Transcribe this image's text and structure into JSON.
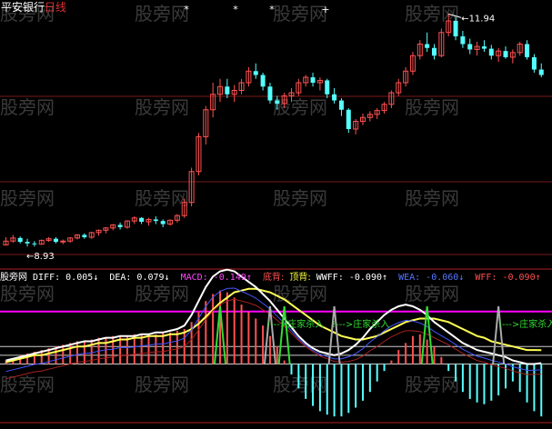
{
  "title": {
    "name": "平安银行",
    "period": "日线"
  },
  "price_annotations": {
    "high": "11.94",
    "low": "8.93"
  },
  "indicator_bar": {
    "name": "股旁网",
    "diff": "DIFF: 0.005↓",
    "dea": "DEA: 0.079↓",
    "macd": "MACD: -0.149↑",
    "bottom_div": "底背:",
    "top_div": "顶背:",
    "wwff": "WWFF: -0.090↑",
    "wea": "WEA: -0.060↓",
    "wff": "WFF: -0.090↑"
  },
  "signal_label": "!--->庄家杀入",
  "watermark": "股旁网",
  "colors": {
    "up": "#ff5050",
    "down": "#55ffff",
    "diff_line": "#ffffff",
    "dea_line": "#ffff55",
    "signal_line": "#ff00ff",
    "grid": "#7a1a1a",
    "sig_green": "#33dd33"
  },
  "chart_data": [
    {
      "type": "candlestick",
      "series": [
        {
          "name": "K线",
          "ohlc": [
            [
              8.95,
              9.05,
              8.95,
              9.0
            ],
            [
              9.0,
              9.08,
              8.98,
              9.04
            ],
            [
              9.04,
              9.06,
              8.97,
              8.99
            ],
            [
              8.99,
              9.03,
              8.93,
              8.97
            ],
            [
              8.97,
              9.0,
              8.93,
              8.96
            ],
            [
              8.96,
              9.02,
              8.95,
              9.01
            ],
            [
              9.01,
              9.05,
              8.99,
              9.03
            ],
            [
              9.03,
              9.05,
              8.97,
              8.99
            ],
            [
              8.99,
              9.02,
              8.96,
              9.0
            ],
            [
              9.0,
              9.05,
              8.98,
              9.04
            ],
            [
              9.04,
              9.09,
              9.02,
              9.08
            ],
            [
              9.08,
              9.1,
              9.03,
              9.05
            ],
            [
              9.05,
              9.12,
              9.03,
              9.11
            ],
            [
              9.11,
              9.15,
              9.07,
              9.14
            ],
            [
              9.14,
              9.18,
              9.1,
              9.17
            ],
            [
              9.17,
              9.22,
              9.14,
              9.21
            ],
            [
              9.21,
              9.24,
              9.15,
              9.18
            ],
            [
              9.18,
              9.27,
              9.16,
              9.26
            ],
            [
              9.26,
              9.32,
              9.22,
              9.3
            ],
            [
              9.3,
              9.31,
              9.22,
              9.25
            ],
            [
              9.25,
              9.3,
              9.2,
              9.28
            ],
            [
              9.28,
              9.32,
              9.22,
              9.26
            ],
            [
              9.26,
              9.28,
              9.18,
              9.22
            ],
            [
              9.22,
              9.28,
              9.2,
              9.27
            ],
            [
              9.27,
              9.35,
              9.24,
              9.33
            ],
            [
              9.33,
              9.55,
              9.3,
              9.5
            ],
            [
              9.5,
              9.95,
              9.45,
              9.9
            ],
            [
              9.9,
              10.4,
              9.85,
              10.35
            ],
            [
              10.35,
              10.75,
              10.25,
              10.7
            ],
            [
              10.7,
              11.05,
              10.6,
              10.9
            ],
            [
              10.9,
              11.1,
              10.8,
              11.0
            ],
            [
              11.0,
              11.1,
              10.85,
              10.9
            ],
            [
              10.9,
              11.02,
              10.8,
              10.95
            ],
            [
              10.95,
              11.1,
              10.9,
              11.05
            ],
            [
              11.05,
              11.25,
              11.0,
              11.2
            ],
            [
              11.2,
              11.3,
              11.1,
              11.15
            ],
            [
              11.15,
              11.18,
              10.95,
              11.0
            ],
            [
              11.0,
              11.05,
              10.78,
              10.82
            ],
            [
              10.82,
              10.88,
              10.7,
              10.78
            ],
            [
              10.78,
              10.92,
              10.72,
              10.88
            ],
            [
              10.88,
              10.98,
              10.8,
              10.92
            ],
            [
              10.92,
              11.1,
              10.88,
              11.05
            ],
            [
              11.05,
              11.15,
              11.0,
              11.12
            ],
            [
              11.12,
              11.18,
              11.0,
              11.05
            ],
            [
              11.05,
              11.12,
              10.95,
              11.08
            ],
            [
              11.08,
              11.1,
              10.85,
              10.9
            ],
            [
              10.9,
              10.98,
              10.78,
              10.82
            ],
            [
              10.82,
              10.85,
              10.62,
              10.7
            ],
            [
              10.7,
              10.72,
              10.4,
              10.45
            ],
            [
              10.45,
              10.58,
              10.38,
              10.55
            ],
            [
              10.55,
              10.65,
              10.5,
              10.6
            ],
            [
              10.6,
              10.68,
              10.55,
              10.64
            ],
            [
              10.64,
              10.72,
              10.58,
              10.69
            ],
            [
              10.69,
              10.8,
              10.65,
              10.77
            ],
            [
              10.77,
              10.95,
              10.72,
              10.92
            ],
            [
              10.92,
              11.1,
              10.88,
              11.05
            ],
            [
              11.05,
              11.25,
              11.0,
              11.2
            ],
            [
              11.2,
              11.45,
              11.15,
              11.4
            ],
            [
              11.4,
              11.6,
              11.35,
              11.55
            ],
            [
              11.55,
              11.7,
              11.45,
              11.5
            ],
            [
              11.5,
              11.55,
              11.35,
              11.4
            ],
            [
              11.4,
              11.75,
              11.38,
              11.7
            ],
            [
              11.7,
              11.94,
              11.65,
              11.85
            ],
            [
              11.85,
              11.9,
              11.6,
              11.65
            ],
            [
              11.65,
              11.72,
              11.5,
              11.55
            ],
            [
              11.55,
              11.62,
              11.42,
              11.48
            ],
            [
              11.48,
              11.58,
              11.4,
              11.52
            ],
            [
              11.52,
              11.6,
              11.45,
              11.49
            ],
            [
              11.49,
              11.54,
              11.35,
              11.4
            ],
            [
              11.4,
              11.5,
              11.32,
              11.46
            ],
            [
              11.46,
              11.52,
              11.36,
              11.38
            ],
            [
              11.38,
              11.48,
              11.3,
              11.44
            ],
            [
              11.44,
              11.58,
              11.4,
              11.55
            ],
            [
              11.55,
              11.6,
              11.35,
              11.38
            ],
            [
              11.38,
              11.42,
              11.18,
              11.22
            ],
            [
              11.22,
              11.3,
              11.12,
              11.15
            ]
          ]
        }
      ],
      "ylim": [
        8.85,
        12.05
      ],
      "annotations": [
        "11.94",
        "8.93"
      ]
    },
    {
      "type": "bar",
      "series": [
        {
          "name": "MACD",
          "values": [
            0.02,
            0.03,
            0.05,
            0.06,
            0.07,
            0.08,
            0.09,
            0.1,
            0.11,
            0.12,
            0.13,
            0.13,
            0.14,
            0.15,
            0.15,
            0.16,
            0.16,
            0.16,
            0.17,
            0.17,
            0.17,
            0.17,
            0.18,
            0.18,
            0.19,
            0.2,
            0.24,
            0.3,
            0.36,
            0.4,
            0.42,
            0.41,
            0.38,
            0.34,
            0.3,
            0.26,
            0.22,
            0.16,
            0.1,
            0.02,
            -0.06,
            -0.14,
            -0.2,
            -0.24,
            -0.27,
            -0.29,
            -0.3,
            -0.3,
            -0.28,
            -0.25,
            -0.21,
            -0.16,
            -0.1,
            -0.04,
            0.02,
            0.08,
            0.12,
            0.16,
            0.17,
            0.14,
            0.1,
            0.04,
            -0.04,
            -0.1,
            -0.16,
            -0.2,
            -0.22,
            -0.23,
            -0.21,
            -0.18,
            -0.14,
            -0.1,
            -0.16,
            -0.22,
            -0.27,
            -0.3
          ]
        },
        {
          "name": "DIFF",
          "values": [
            0.02,
            0.03,
            0.04,
            0.05,
            0.06,
            0.07,
            0.08,
            0.09,
            0.1,
            0.11,
            0.12,
            0.13,
            0.13,
            0.14,
            0.15,
            0.15,
            0.16,
            0.16,
            0.16,
            0.17,
            0.17,
            0.18,
            0.18,
            0.19,
            0.2,
            0.22,
            0.28,
            0.36,
            0.44,
            0.5,
            0.53,
            0.54,
            0.53,
            0.5,
            0.47,
            0.44,
            0.4,
            0.36,
            0.31,
            0.26,
            0.21,
            0.16,
            0.12,
            0.09,
            0.07,
            0.06,
            0.05,
            0.06,
            0.08,
            0.11,
            0.15,
            0.2,
            0.24,
            0.28,
            0.31,
            0.33,
            0.34,
            0.33,
            0.31,
            0.28,
            0.24,
            0.21,
            0.18,
            0.15,
            0.12,
            0.1,
            0.08,
            0.07,
            0.06,
            0.05,
            0.04,
            0.02,
            0.01,
            0.0,
            0.0,
            0.005
          ]
        },
        {
          "name": "DEA",
          "values": [
            0.01,
            0.02,
            0.03,
            0.04,
            0.05,
            0.05,
            0.06,
            0.07,
            0.08,
            0.09,
            0.1,
            0.1,
            0.11,
            0.12,
            0.12,
            0.13,
            0.14,
            0.14,
            0.15,
            0.15,
            0.16,
            0.16,
            0.16,
            0.17,
            0.17,
            0.18,
            0.2,
            0.23,
            0.27,
            0.31,
            0.35,
            0.38,
            0.41,
            0.42,
            0.43,
            0.43,
            0.42,
            0.41,
            0.39,
            0.37,
            0.34,
            0.31,
            0.28,
            0.25,
            0.22,
            0.2,
            0.18,
            0.16,
            0.15,
            0.14,
            0.14,
            0.15,
            0.16,
            0.18,
            0.2,
            0.22,
            0.24,
            0.25,
            0.26,
            0.26,
            0.26,
            0.25,
            0.24,
            0.22,
            0.2,
            0.18,
            0.16,
            0.15,
            0.13,
            0.12,
            0.11,
            0.1,
            0.09,
            0.08,
            0.08,
            0.079
          ]
        }
      ],
      "ylim": [
        -0.32,
        0.46
      ]
    }
  ]
}
